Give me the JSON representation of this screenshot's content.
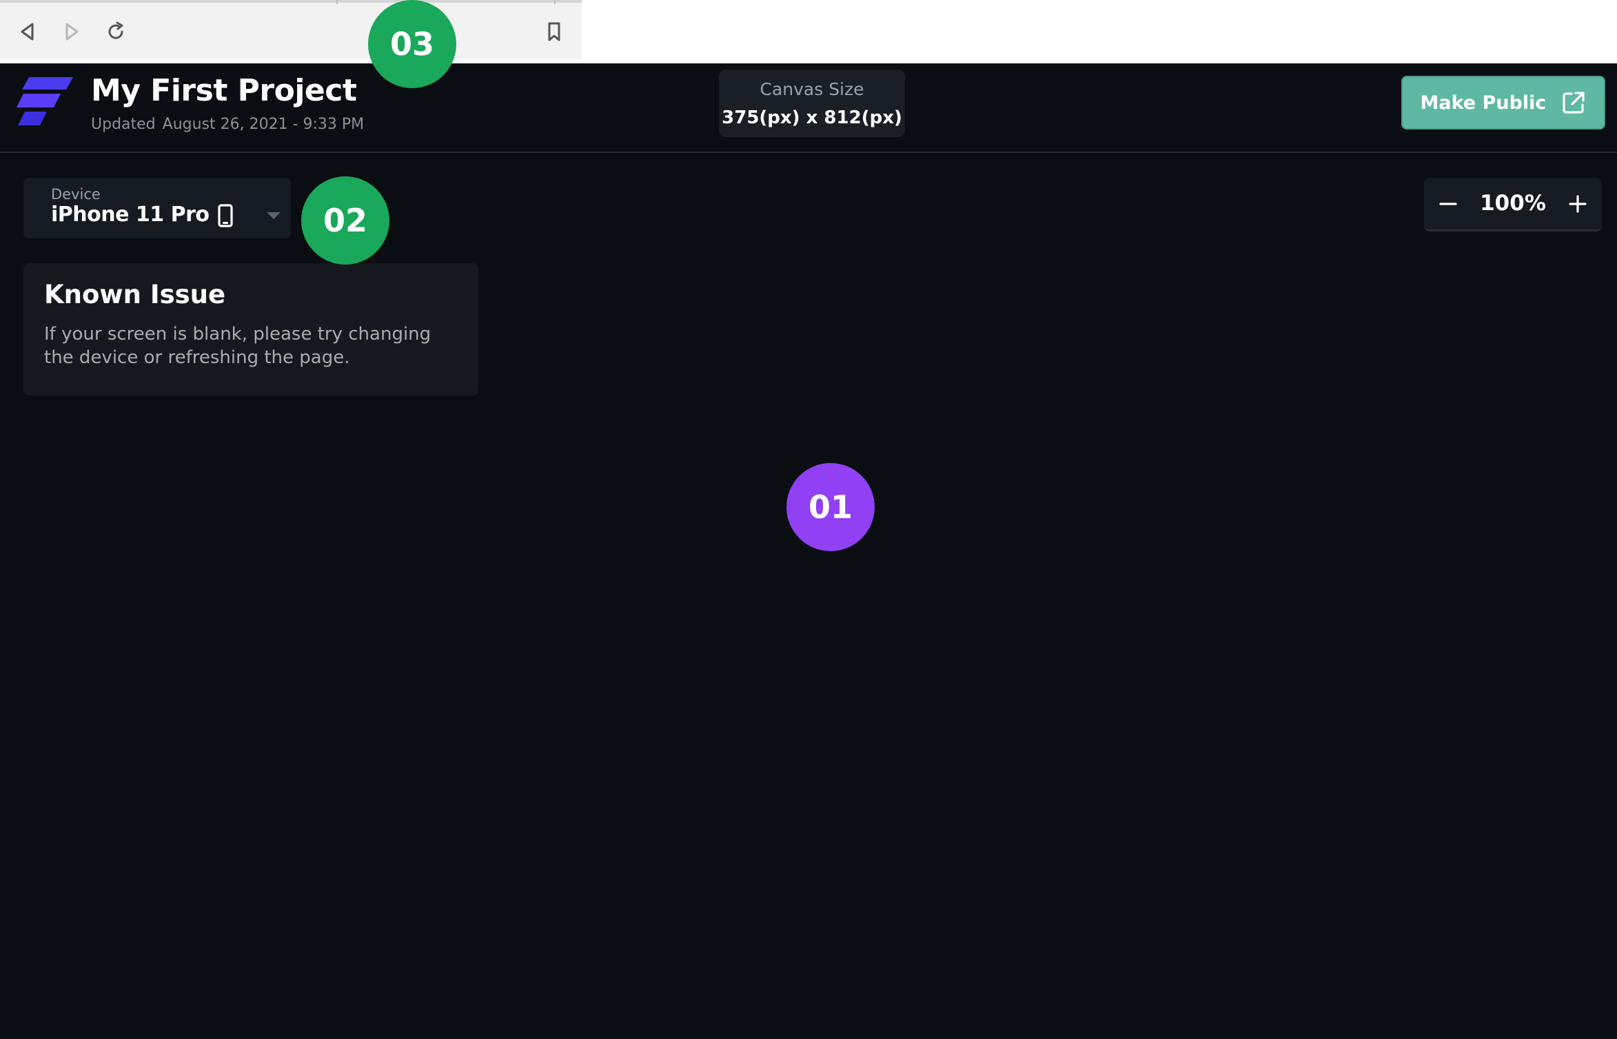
{
  "header": {
    "project_title": "My First Project",
    "updated_label": "Updated",
    "updated_value": "August 26, 2021 - 9:33 PM",
    "canvas_size_label": "Canvas Size",
    "canvas_size_value": "375(px) x 812(px)",
    "make_public_label": "Make Public",
    "logo_color": "#4a3cf0"
  },
  "device": {
    "label": "Device",
    "selected": "iPhone 11 Pro"
  },
  "known_issue": {
    "title": "Known Issue",
    "body": "If your screen is blank, please try changing the device or refreshing the page."
  },
  "zoom": {
    "value": "100%"
  },
  "markers": {
    "m01": "01",
    "m02": "02",
    "m03": "03"
  },
  "colors": {
    "background": "#0a0e13",
    "accent_teal": "#5fb8a1",
    "marker_green": "#1aa85a",
    "marker_purple": "#9140f4"
  },
  "icons": [
    "back-arrow-icon",
    "forward-arrow-icon",
    "reload-icon",
    "bookmark-icon",
    "external-link-icon",
    "phone-icon",
    "chevron-down-icon",
    "minus-icon",
    "plus-icon"
  ]
}
